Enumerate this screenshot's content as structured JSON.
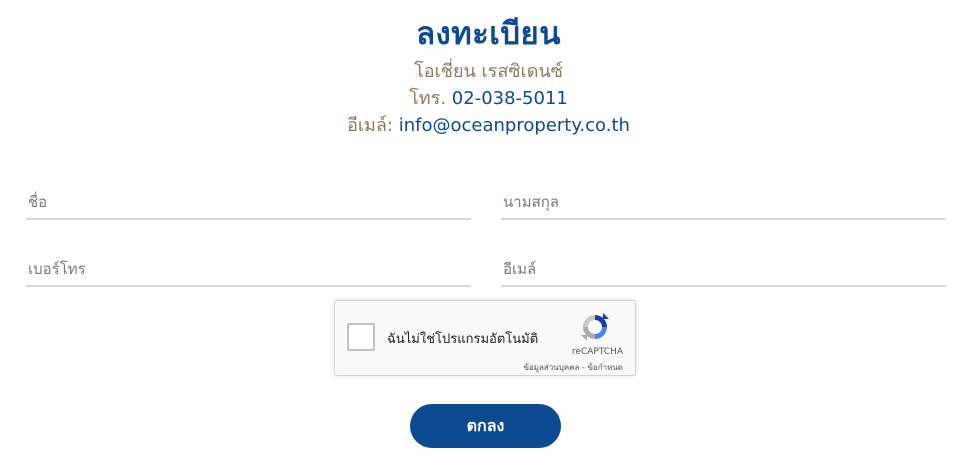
{
  "header": {
    "title": "ลงทะเบียน",
    "company": "โอเชี่ยน เรสซิเดนซ์",
    "phone_label": "โทร.",
    "phone": "02-038-5011",
    "email_label": "อีเมล์:",
    "email": "info@oceanproperty.co.th"
  },
  "form": {
    "first_name_placeholder": "ชื่อ",
    "last_name_placeholder": "นามสกุล",
    "phone_placeholder": "เบอร์โทร",
    "email_placeholder": "อีเมล์"
  },
  "captcha": {
    "label": "ฉันไม่ใช่โปรแกรมอัตโนมัติ",
    "brand": "reCAPTCHA",
    "privacy": "ข้อมูลส่วนบุคคล",
    "separator": " - ",
    "terms": "ข้อกำหนด",
    "icon": "recaptcha-logo-icon"
  },
  "submit_label": "ตกลง",
  "colors": {
    "brand_blue": "#0d4a91",
    "muted_gold": "#8a7a62",
    "underline": "#d6d6d6"
  }
}
